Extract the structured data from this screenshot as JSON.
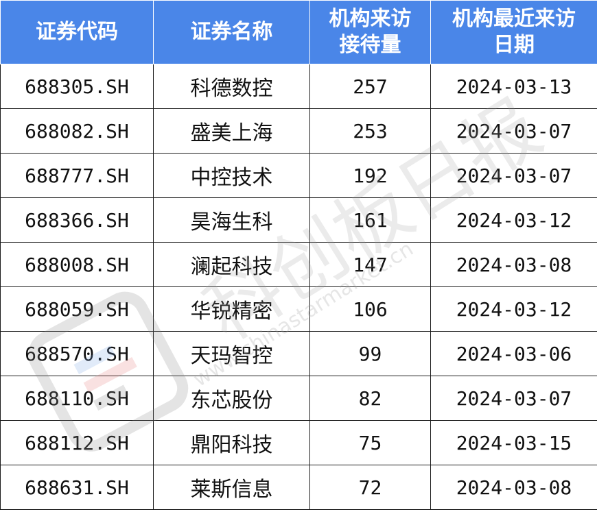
{
  "table": {
    "headers": [
      "证券代码",
      "证券名称",
      "机构来访接待量",
      "机构最近来访日期"
    ],
    "header_lines": [
      [
        "证券代码"
      ],
      [
        "证券名称"
      ],
      [
        "机构来访",
        "接待量"
      ],
      [
        "机构最近来访",
        "日期"
      ]
    ],
    "rows": [
      {
        "code": "688305.SH",
        "name": "科德数控",
        "visits": "257",
        "date": "2024-03-13"
      },
      {
        "code": "688082.SH",
        "name": "盛美上海",
        "visits": "253",
        "date": "2024-03-07"
      },
      {
        "code": "688777.SH",
        "name": "中控技术",
        "visits": "192",
        "date": "2024-03-07"
      },
      {
        "code": "688366.SH",
        "name": "昊海生科",
        "visits": "161",
        "date": "2024-03-12"
      },
      {
        "code": "688008.SH",
        "name": "澜起科技",
        "visits": "147",
        "date": "2024-03-08"
      },
      {
        "code": "688059.SH",
        "name": "华锐精密",
        "visits": "106",
        "date": "2024-03-12"
      },
      {
        "code": "688570.SH",
        "name": "天玛智控",
        "visits": "99",
        "date": "2024-03-06"
      },
      {
        "code": "688110.SH",
        "name": "东芯股份",
        "visits": "82",
        "date": "2024-03-07"
      },
      {
        "code": "688112.SH",
        "name": "鼎阳科技",
        "visits": "75",
        "date": "2024-03-15"
      },
      {
        "code": "688631.SH",
        "name": "莱斯信息",
        "visits": "72",
        "date": "2024-03-08"
      }
    ]
  },
  "watermark": {
    "text": "科创板日报",
    "url": "www.chinastarmarket.cn"
  },
  "colors": {
    "header_bg": "#4a86e8",
    "header_text": "#ffffff",
    "border": "#1a1a1a"
  }
}
